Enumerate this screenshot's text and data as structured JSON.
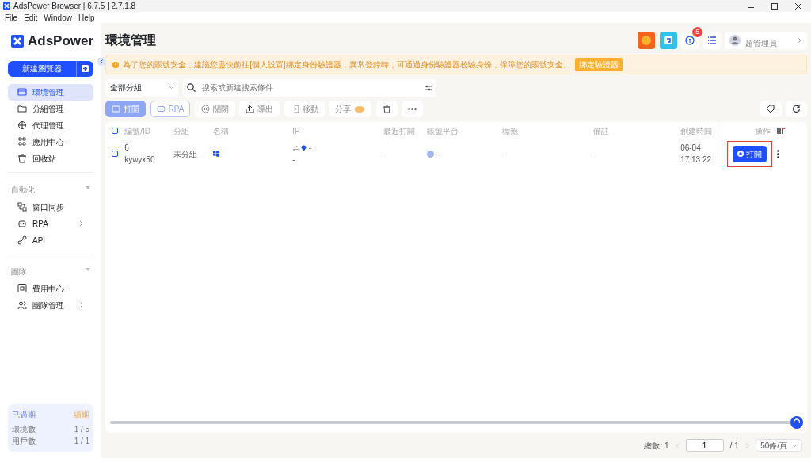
{
  "window": {
    "title": "AdsPower Browser | 6.7.5 | 2.7.1.8"
  },
  "menu": [
    "File",
    "Edit",
    "Window",
    "Help"
  ],
  "sidebar": {
    "logo": "AdsPower",
    "new_button": "新建瀏覽器",
    "items": [
      {
        "label": "環境管理",
        "selected": true,
        "has_arrow": false
      },
      {
        "label": "分組管理",
        "selected": false,
        "has_arrow": false
      },
      {
        "label": "代理管理",
        "selected": false,
        "has_arrow": false
      },
      {
        "label": "應用中心",
        "selected": false,
        "has_arrow": false
      },
      {
        "label": "回收站",
        "selected": false,
        "has_arrow": false
      }
    ],
    "sections": [
      {
        "title": "自動化",
        "items": [
          {
            "label": "窗口同步",
            "selected": false,
            "has_arrow": false
          },
          {
            "label": "RPA",
            "selected": false,
            "has_arrow": true
          },
          {
            "label": "API",
            "selected": false,
            "has_arrow": false
          }
        ]
      },
      {
        "title": "團隊",
        "items": [
          {
            "label": "費用中心",
            "selected": false,
            "has_arrow": false
          },
          {
            "label": "團隊管理",
            "selected": false,
            "has_arrow": true
          }
        ]
      }
    ],
    "plan": {
      "status": "已過期",
      "renew": "續期",
      "rows": [
        {
          "label": "環境數",
          "value": "1 / 5"
        },
        {
          "label": "用戶數",
          "value": "1 / 1"
        }
      ]
    }
  },
  "header": {
    "title": "環境管理",
    "notification_count": "5",
    "user_role": "超管理員"
  },
  "warning": {
    "text": "為了您的賬號安全，建議您盡快前往[個人設置]綁定身份驗證器，異常登錄時，可通過身份驗證器校驗身份，保障您的賬號安全。",
    "button": "綁定驗證器"
  },
  "filter": {
    "group": "全部分組",
    "search_placeholder": "搜索或新建搜索條件"
  },
  "toolbar": [
    {
      "label": "打開",
      "kind": "primary"
    },
    {
      "label": "RPA",
      "kind": "outline"
    },
    {
      "label": "關閉",
      "kind": "plain"
    },
    {
      "label": "導出",
      "kind": "plain"
    },
    {
      "label": "移動",
      "kind": "plain"
    },
    {
      "label": "分享",
      "kind": "share"
    }
  ],
  "table": {
    "select_all": {
      "checked": false
    },
    "columns": [
      "編號/ID",
      "分組",
      "名稱",
      "IP",
      "最近打開",
      "賬號平台",
      "標籤",
      "備註",
      "創建時間",
      "操作"
    ],
    "rows": [
      {
        "checked": false,
        "number": "6",
        "id": "kywyx50",
        "group": "未分組",
        "ip": "-",
        "ip_sub": "-",
        "last_open": "-",
        "platform": "-",
        "tags": "-",
        "notes": "-",
        "date": "06-04",
        "time": "17:13:22",
        "action": "打開"
      }
    ]
  },
  "footer": {
    "total": "總數: 1",
    "page": "1",
    "pages": "/ 1",
    "page_size": "50條/頁"
  }
}
